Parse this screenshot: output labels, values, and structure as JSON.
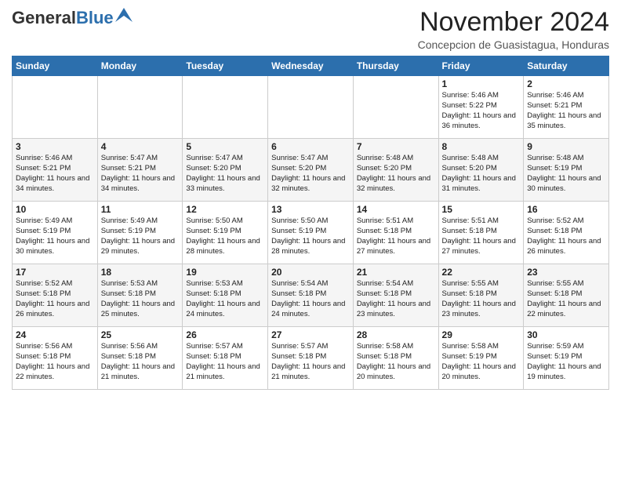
{
  "header": {
    "logo_general": "General",
    "logo_blue": "Blue",
    "month_title": "November 2024",
    "location": "Concepcion de Guasistagua, Honduras"
  },
  "days_of_week": [
    "Sunday",
    "Monday",
    "Tuesday",
    "Wednesday",
    "Thursday",
    "Friday",
    "Saturday"
  ],
  "weeks": [
    [
      {
        "day": "",
        "info": ""
      },
      {
        "day": "",
        "info": ""
      },
      {
        "day": "",
        "info": ""
      },
      {
        "day": "",
        "info": ""
      },
      {
        "day": "",
        "info": ""
      },
      {
        "day": "1",
        "info": "Sunrise: 5:46 AM\nSunset: 5:22 PM\nDaylight: 11 hours and 36 minutes."
      },
      {
        "day": "2",
        "info": "Sunrise: 5:46 AM\nSunset: 5:21 PM\nDaylight: 11 hours and 35 minutes."
      }
    ],
    [
      {
        "day": "3",
        "info": "Sunrise: 5:46 AM\nSunset: 5:21 PM\nDaylight: 11 hours and 34 minutes."
      },
      {
        "day": "4",
        "info": "Sunrise: 5:47 AM\nSunset: 5:21 PM\nDaylight: 11 hours and 34 minutes."
      },
      {
        "day": "5",
        "info": "Sunrise: 5:47 AM\nSunset: 5:20 PM\nDaylight: 11 hours and 33 minutes."
      },
      {
        "day": "6",
        "info": "Sunrise: 5:47 AM\nSunset: 5:20 PM\nDaylight: 11 hours and 32 minutes."
      },
      {
        "day": "7",
        "info": "Sunrise: 5:48 AM\nSunset: 5:20 PM\nDaylight: 11 hours and 32 minutes."
      },
      {
        "day": "8",
        "info": "Sunrise: 5:48 AM\nSunset: 5:20 PM\nDaylight: 11 hours and 31 minutes."
      },
      {
        "day": "9",
        "info": "Sunrise: 5:48 AM\nSunset: 5:19 PM\nDaylight: 11 hours and 30 minutes."
      }
    ],
    [
      {
        "day": "10",
        "info": "Sunrise: 5:49 AM\nSunset: 5:19 PM\nDaylight: 11 hours and 30 minutes."
      },
      {
        "day": "11",
        "info": "Sunrise: 5:49 AM\nSunset: 5:19 PM\nDaylight: 11 hours and 29 minutes."
      },
      {
        "day": "12",
        "info": "Sunrise: 5:50 AM\nSunset: 5:19 PM\nDaylight: 11 hours and 28 minutes."
      },
      {
        "day": "13",
        "info": "Sunrise: 5:50 AM\nSunset: 5:19 PM\nDaylight: 11 hours and 28 minutes."
      },
      {
        "day": "14",
        "info": "Sunrise: 5:51 AM\nSunset: 5:18 PM\nDaylight: 11 hours and 27 minutes."
      },
      {
        "day": "15",
        "info": "Sunrise: 5:51 AM\nSunset: 5:18 PM\nDaylight: 11 hours and 27 minutes."
      },
      {
        "day": "16",
        "info": "Sunrise: 5:52 AM\nSunset: 5:18 PM\nDaylight: 11 hours and 26 minutes."
      }
    ],
    [
      {
        "day": "17",
        "info": "Sunrise: 5:52 AM\nSunset: 5:18 PM\nDaylight: 11 hours and 26 minutes."
      },
      {
        "day": "18",
        "info": "Sunrise: 5:53 AM\nSunset: 5:18 PM\nDaylight: 11 hours and 25 minutes."
      },
      {
        "day": "19",
        "info": "Sunrise: 5:53 AM\nSunset: 5:18 PM\nDaylight: 11 hours and 24 minutes."
      },
      {
        "day": "20",
        "info": "Sunrise: 5:54 AM\nSunset: 5:18 PM\nDaylight: 11 hours and 24 minutes."
      },
      {
        "day": "21",
        "info": "Sunrise: 5:54 AM\nSunset: 5:18 PM\nDaylight: 11 hours and 23 minutes."
      },
      {
        "day": "22",
        "info": "Sunrise: 5:55 AM\nSunset: 5:18 PM\nDaylight: 11 hours and 23 minutes."
      },
      {
        "day": "23",
        "info": "Sunrise: 5:55 AM\nSunset: 5:18 PM\nDaylight: 11 hours and 22 minutes."
      }
    ],
    [
      {
        "day": "24",
        "info": "Sunrise: 5:56 AM\nSunset: 5:18 PM\nDaylight: 11 hours and 22 minutes."
      },
      {
        "day": "25",
        "info": "Sunrise: 5:56 AM\nSunset: 5:18 PM\nDaylight: 11 hours and 21 minutes."
      },
      {
        "day": "26",
        "info": "Sunrise: 5:57 AM\nSunset: 5:18 PM\nDaylight: 11 hours and 21 minutes."
      },
      {
        "day": "27",
        "info": "Sunrise: 5:57 AM\nSunset: 5:18 PM\nDaylight: 11 hours and 21 minutes."
      },
      {
        "day": "28",
        "info": "Sunrise: 5:58 AM\nSunset: 5:18 PM\nDaylight: 11 hours and 20 minutes."
      },
      {
        "day": "29",
        "info": "Sunrise: 5:58 AM\nSunset: 5:19 PM\nDaylight: 11 hours and 20 minutes."
      },
      {
        "day": "30",
        "info": "Sunrise: 5:59 AM\nSunset: 5:19 PM\nDaylight: 11 hours and 19 minutes."
      }
    ]
  ],
  "colors": {
    "header_bg": "#2c6fad",
    "logo_blue": "#2c6fad"
  }
}
